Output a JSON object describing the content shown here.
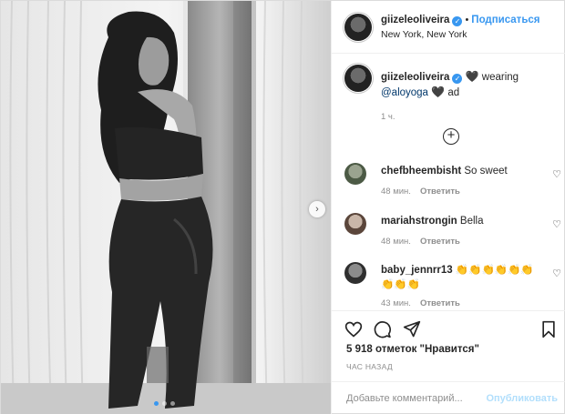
{
  "post": {
    "username": "giizeleoliveira",
    "location": "New York, New York",
    "follow_label": "Подписаться",
    "header_separator": "•"
  },
  "caption": {
    "username": "giizeleoliveira",
    "heart": "🖤",
    "text_before_mention": "wearing",
    "mention": "@aloyoga",
    "text_after_mention": "ad",
    "time": "1 ч."
  },
  "more_comments_icon": "plus-circle-icon",
  "comments": [
    {
      "username": "chefbheembisht",
      "text": "So sweet",
      "time": "48 мин.",
      "reply": "Ответить"
    },
    {
      "username": "mariahstrongin",
      "text": "Bella",
      "time": "48 мин.",
      "reply": "Ответить"
    },
    {
      "username": "baby_jennrr13",
      "text": "👏👏👏👏👏👏👏👏👏",
      "time": "43 мин.",
      "reply": "Ответить"
    }
  ],
  "actions": {
    "icons": [
      "heart-icon",
      "comment-icon",
      "share-icon",
      "bookmark-icon"
    ]
  },
  "likes": "5 918 отметок \"Нравится\"",
  "posted_ago": "ЧАС НАЗАД",
  "add_comment": {
    "placeholder": "Добавьте комментарий...",
    "publish_label": "Опубликовать"
  },
  "colors": {
    "accent": "#3897f0",
    "publish_disabled": "#b2dffc",
    "muted": "#8e8e8e",
    "text": "#262626"
  }
}
